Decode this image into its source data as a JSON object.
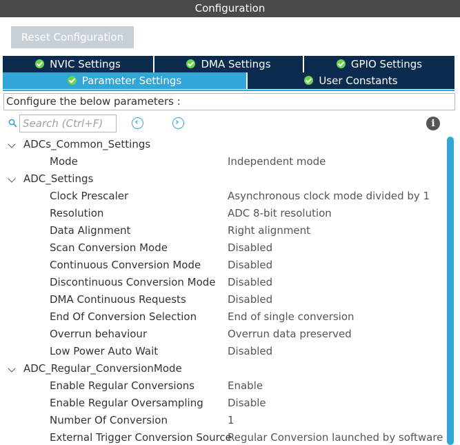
{
  "window": {
    "title": "Configuration"
  },
  "toolbar": {
    "reset_label": "Reset Configuration"
  },
  "tabs": [
    {
      "label": "NVIC Settings",
      "active": false
    },
    {
      "label": "DMA Settings",
      "active": false
    },
    {
      "label": "GPIO Settings",
      "active": false
    },
    {
      "label": "Parameter Settings",
      "active": true
    },
    {
      "label": "User Constants",
      "active": false
    }
  ],
  "hint": "Configure the below parameters :",
  "search": {
    "placeholder": "Search (Ctrl+F)"
  },
  "groups": [
    {
      "label": "ADCs_Common_Settings",
      "params": [
        {
          "name": "Mode",
          "value": "Independent mode"
        }
      ]
    },
    {
      "label": "ADC_Settings",
      "params": [
        {
          "name": "Clock Prescaler",
          "value": "Asynchronous clock mode divided by 1"
        },
        {
          "name": "Resolution",
          "value": "ADC 8-bit resolution"
        },
        {
          "name": "Data Alignment",
          "value": "Right alignment"
        },
        {
          "name": "Scan Conversion Mode",
          "value": "Disabled"
        },
        {
          "name": "Continuous Conversion Mode",
          "value": "Disabled"
        },
        {
          "name": "Discontinuous Conversion Mode",
          "value": "Disabled"
        },
        {
          "name": "DMA Continuous Requests",
          "value": "Disabled"
        },
        {
          "name": "End Of Conversion Selection",
          "value": "End of single conversion"
        },
        {
          "name": "Overrun behaviour",
          "value": "Overrun data preserved"
        },
        {
          "name": "Low Power Auto Wait",
          "value": "Disabled"
        }
      ]
    },
    {
      "label": "ADC_Regular_ConversionMode",
      "params": [
        {
          "name": "Enable Regular Conversions",
          "value": "Enable"
        },
        {
          "name": "Enable Regular Oversampling",
          "value": "Disable"
        },
        {
          "name": "Number Of Conversion",
          "value": "1"
        },
        {
          "name": "External Trigger Conversion Source",
          "value": "Regular Conversion launched by software"
        }
      ]
    }
  ],
  "colors": {
    "titlebar": "#4a4a4a",
    "tab_inactive": "#0b2b4f",
    "tab_active": "#33a6d8",
    "check": "#6cd34d",
    "accent": "#33a6d8"
  }
}
